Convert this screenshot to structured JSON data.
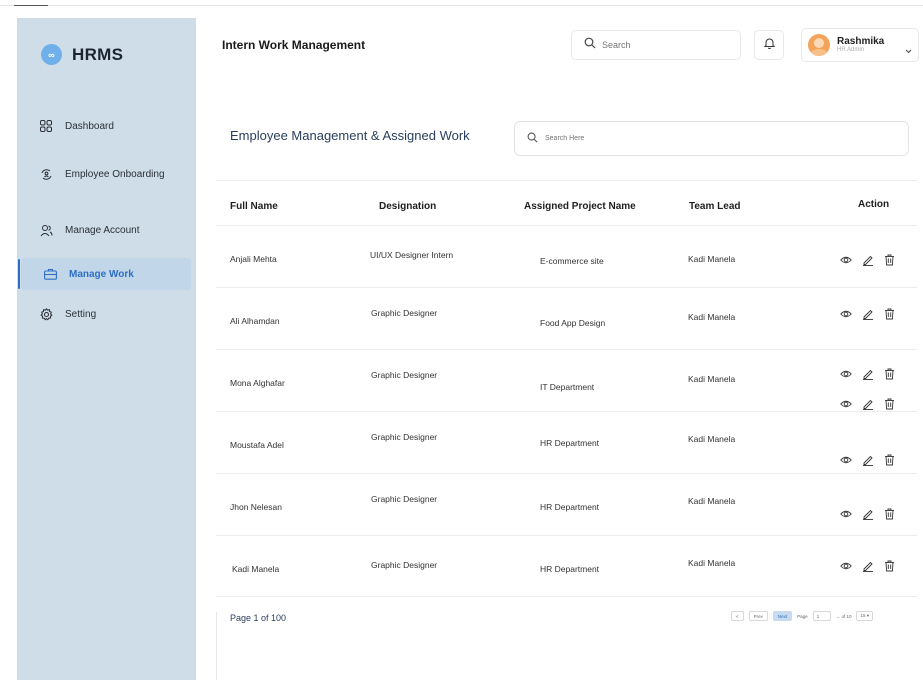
{
  "app": {
    "name": "HRMS",
    "logo_text": "∞"
  },
  "sidebar": {
    "items": [
      {
        "label": "Dashboard",
        "icon": "grid-icon",
        "active": false
      },
      {
        "label": "Employee Onboarding",
        "icon": "refresh-user-icon",
        "active": false
      },
      {
        "label": "Manage Account",
        "icon": "users-icon",
        "active": false
      },
      {
        "label": "Manage Work",
        "icon": "briefcase-icon",
        "active": true
      },
      {
        "label": "Setting",
        "icon": "gear-icon",
        "active": false
      }
    ]
  },
  "header": {
    "title": "Intern Work Management",
    "search_placeholder": "Search",
    "user": {
      "name": "Rashmika",
      "role": "HR Admin"
    }
  },
  "content": {
    "title": "Employee Management & Assigned Work",
    "search_placeholder": "Search Here"
  },
  "table": {
    "columns": [
      "Full Name",
      "Designation",
      "Assigned Project Name",
      "Team Lead",
      "Action"
    ],
    "rows": [
      {
        "name": "Anjali Mehta",
        "designation": "UI/UX  Designer Intern",
        "project": "E-commerce site",
        "lead": "Kadi Manela"
      },
      {
        "name": "Ali Alhamdan",
        "designation": "Graphic Designer",
        "project": "Food App Design",
        "lead": "Kadi Manela"
      },
      {
        "name": "Mona Alghafar",
        "designation": "Graphic Designer",
        "project": "IT Department",
        "lead": "Kadi Manela"
      },
      {
        "name": "Moustafa Adel",
        "designation": "Graphic Designer",
        "project": "HR Department",
        "lead": "Kadi Manela"
      },
      {
        "name": "Jhon Nelesan",
        "designation": "Graphic Designer",
        "project": "HR Department",
        "lead": "Kadi Manela"
      },
      {
        "name": "Kadi Manela",
        "designation": "Graphic Designer",
        "project": "HR Department",
        "lead": "Kadi Manela"
      }
    ]
  },
  "pagination": {
    "info": "Page 1 of 100",
    "first_label": "<",
    "prev_label": "Prev",
    "next_label": "Next",
    "page_label": "Page",
    "page_value": "1",
    "go_label": "→ of 10",
    "per_page": "15 ▾"
  },
  "colors": {
    "accent": "#2d6fc4",
    "sidebar_bg": "#cfdde8"
  }
}
